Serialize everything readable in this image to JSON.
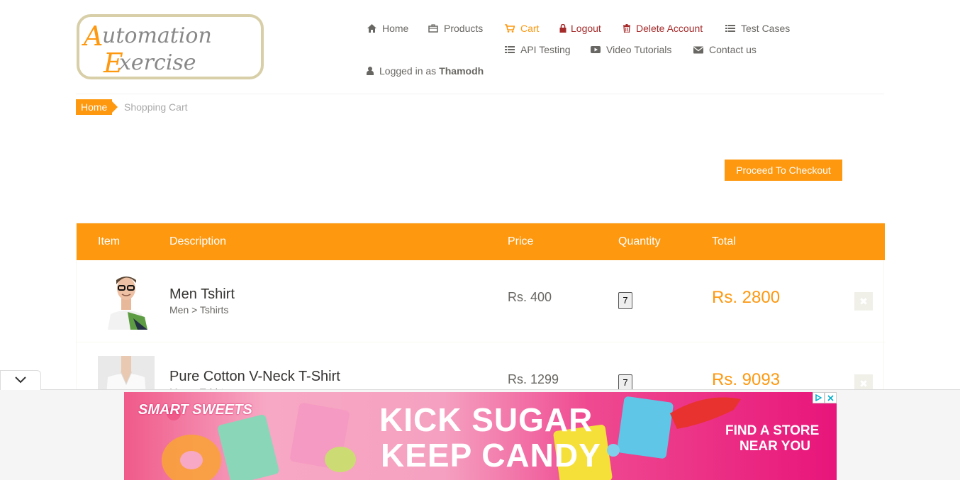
{
  "header": {
    "logo": {
      "line1": "Automation",
      "line2": "Exercise"
    },
    "nav": {
      "home": "Home",
      "products": "Products",
      "cart": "Cart",
      "logout": "Logout",
      "delete_account": "Delete Account",
      "test_cases": "Test Cases",
      "api_testing": "API Testing",
      "video_tutorials": "Video Tutorials",
      "contact_us": "Contact us",
      "logged_in_prefix": "Logged in as",
      "username": "Thamodh"
    }
  },
  "breadcrumb": {
    "home": "Home",
    "current": "Shopping Cart"
  },
  "checkout_label": "Proceed To Checkout",
  "cart": {
    "columns": {
      "item": "Item",
      "description": "Description",
      "price": "Price",
      "quantity": "Quantity",
      "total": "Total"
    },
    "rows": [
      {
        "name": "Men Tshirt",
        "category": "Men > Tshirts",
        "price": "Rs. 400",
        "quantity": "7",
        "total": "Rs. 2800"
      },
      {
        "name": "Pure Cotton V-Neck T-Shirt",
        "category": "Men > Tshirts",
        "price": "Rs. 1299",
        "quantity": "7",
        "total": "Rs. 9093"
      }
    ]
  },
  "ad": {
    "brand": "SMART SWEETS",
    "headline1": "KICK SUGAR",
    "headline2": "KEEP CANDY",
    "cta1": "FIND A STORE",
    "cta2": "NEAR YOU"
  },
  "colors": {
    "accent": "#fe980f",
    "danger": "#a52a2a",
    "text": "#696763"
  },
  "icons": [
    "home-icon",
    "products-icon",
    "cart-icon",
    "lock-icon",
    "trash-icon",
    "list-icon",
    "video-icon",
    "envelope-icon",
    "user-icon",
    "chevron-down-icon",
    "close-icon",
    "adchoices-icon"
  ]
}
